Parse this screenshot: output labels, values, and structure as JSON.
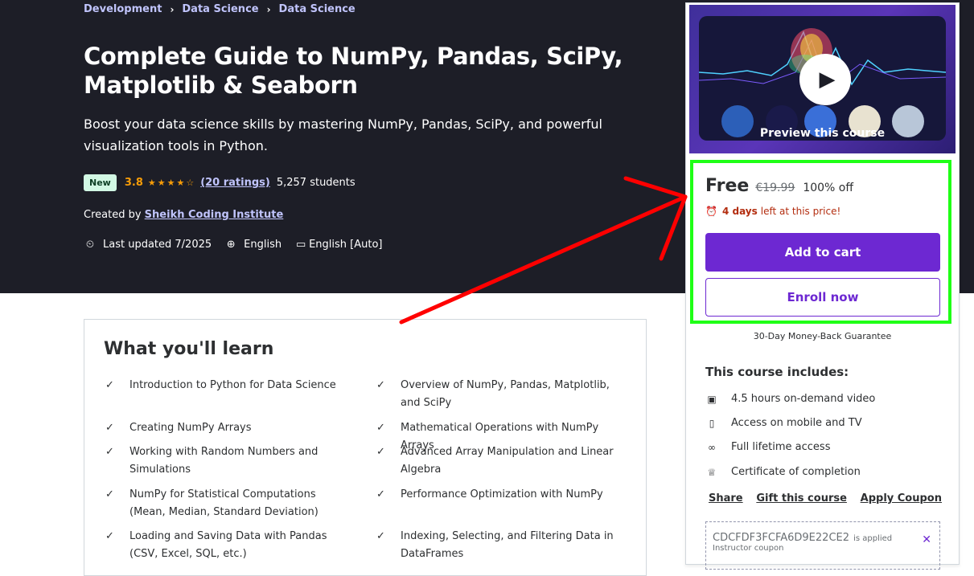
{
  "breadcrumb": [
    "Development",
    "Data Science",
    "Data Science"
  ],
  "course": {
    "title": "Complete Guide to NumPy, Pandas, SciPy, Matplotlib & Seaborn",
    "subtitle": "Boost your data science skills by mastering NumPy, Pandas, SciPy, and powerful visualization tools in Python.",
    "badge": "New",
    "rating": "3.8",
    "ratings_link": "(20 ratings)",
    "students": "5,257 students",
    "created_by_label": "Created by",
    "instructor": "Sheikh Coding Institute",
    "last_updated": "Last updated 7/2025",
    "language": "English",
    "captions": "English [Auto]"
  },
  "learn": {
    "title": "What you'll learn",
    "items": [
      "Introduction to Python for Data Science",
      "Overview of NumPy, Pandas, Matplotlib, and SciPy",
      "Creating NumPy Arrays",
      "Mathematical Operations with NumPy Arrays",
      "Working with Random Numbers and Simulations",
      "Advanced Array Manipulation and Linear Algebra",
      "NumPy for Statistical Computations (Mean, Median, Standard Deviation)",
      "Performance Optimization with NumPy",
      "Loading and Saving Data with Pandas (CSV, Excel, SQL, etc.)",
      "Indexing, Selecting, and Filtering Data in DataFrames"
    ]
  },
  "sidebar": {
    "preview_label": "Preview this course",
    "price_now": "Free",
    "price_old": "€19.99",
    "price_off": "100% off",
    "timer_days": "4 days",
    "timer_rest": "left at this price!",
    "add_to_cart": "Add to cart",
    "enroll_now": "Enroll now",
    "guarantee": "30-Day Money-Back Guarantee",
    "includes_title": "This course includes:",
    "includes": [
      "4.5 hours on-demand video",
      "Access on mobile and TV",
      "Full lifetime access",
      "Certificate of completion"
    ],
    "links": [
      "Share",
      "Gift this course",
      "Apply Coupon"
    ],
    "coupon_code": "CDCFDF3FCFA6D9E22CE2",
    "coupon_applied": "is applied",
    "coupon_note": "Instructor coupon"
  },
  "colors": {
    "hero_bg": "#1d1e27",
    "accent": "#6d28d2",
    "highlight": "#1fff16",
    "arrow": "#ff0000"
  }
}
